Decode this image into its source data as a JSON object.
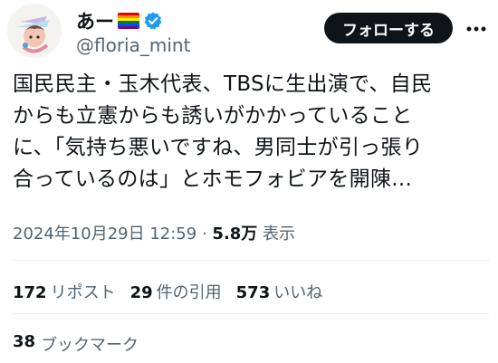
{
  "author": {
    "display_name": "あー",
    "handle": "@floria_mint",
    "flag_icon": "rainbow-flag-icon",
    "verified_icon": "verified-badge-icon",
    "verified_color": "#1d9bf0"
  },
  "follow_label": "フォローする",
  "tweet": {
    "lines": [
      "国民民主・玉木代表、TBSに生出演で、自民",
      "からも立憲からも誘いがかかっていること",
      "に、「気持ち悪いですね、男同士が引っ張り",
      "合っているのは」とホモフォビアを開陳..."
    ]
  },
  "meta": {
    "timestamp": "2024年10月29日 12:59",
    "separator": "·",
    "views_count": "5.8万",
    "views_label": "表示"
  },
  "stats": {
    "reposts_count": "172",
    "reposts_label": "リポスト",
    "quotes_count": "29",
    "quotes_label": "件の引用",
    "likes_count": "573",
    "likes_label": "いいね",
    "bookmarks_count": "38",
    "bookmarks_label": "ブックマーク"
  }
}
